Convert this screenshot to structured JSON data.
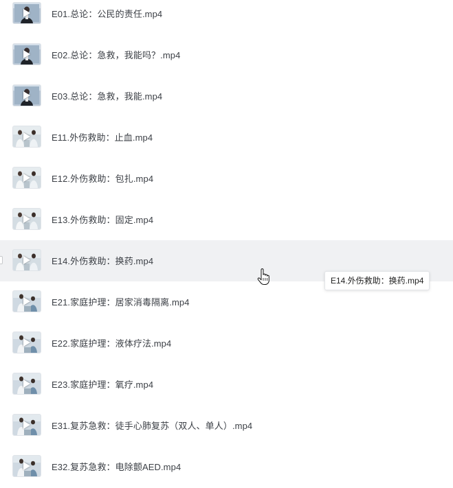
{
  "files": [
    {
      "name": "E01.总论：公民的责任.mp4",
      "thumb": "lecture"
    },
    {
      "name": "E02.总论：急救，我能吗？.mp4",
      "thumb": "lecture"
    },
    {
      "name": "E03.总论：急救，我能.mp4",
      "thumb": "lecture"
    },
    {
      "name": "E11.外伤救助：止血.mp4",
      "thumb": "clinic"
    },
    {
      "name": "E12.外伤救助：包扎.mp4",
      "thumb": "clinic"
    },
    {
      "name": "E13.外伤救助：固定.mp4",
      "thumb": "clinic"
    },
    {
      "name": "E14.外伤救助：换药.mp4",
      "thumb": "clinic",
      "hovered": true
    },
    {
      "name": "E21.家庭护理：居家消毒隔离.mp4",
      "thumb": "home"
    },
    {
      "name": "E22.家庭护理：液体疗法.mp4",
      "thumb": "home"
    },
    {
      "name": "E23.家庭护理：氧疗.mp4",
      "thumb": "home"
    },
    {
      "name": "E31.复苏急救：徒手心肺复苏（双人、单人）.mp4",
      "thumb": "home"
    },
    {
      "name": "E32.复苏急救：电除颤AED.mp4",
      "thumb": "home"
    }
  ],
  "tooltip": {
    "text": "E14.外伤救助：换药.mp4"
  },
  "icons": {
    "thumbnail_overlay": "play-icon",
    "cursor": "hand-pointer-icon"
  },
  "colors": {
    "hover_row": "#f0f1f3",
    "text": "#3b3f45"
  }
}
